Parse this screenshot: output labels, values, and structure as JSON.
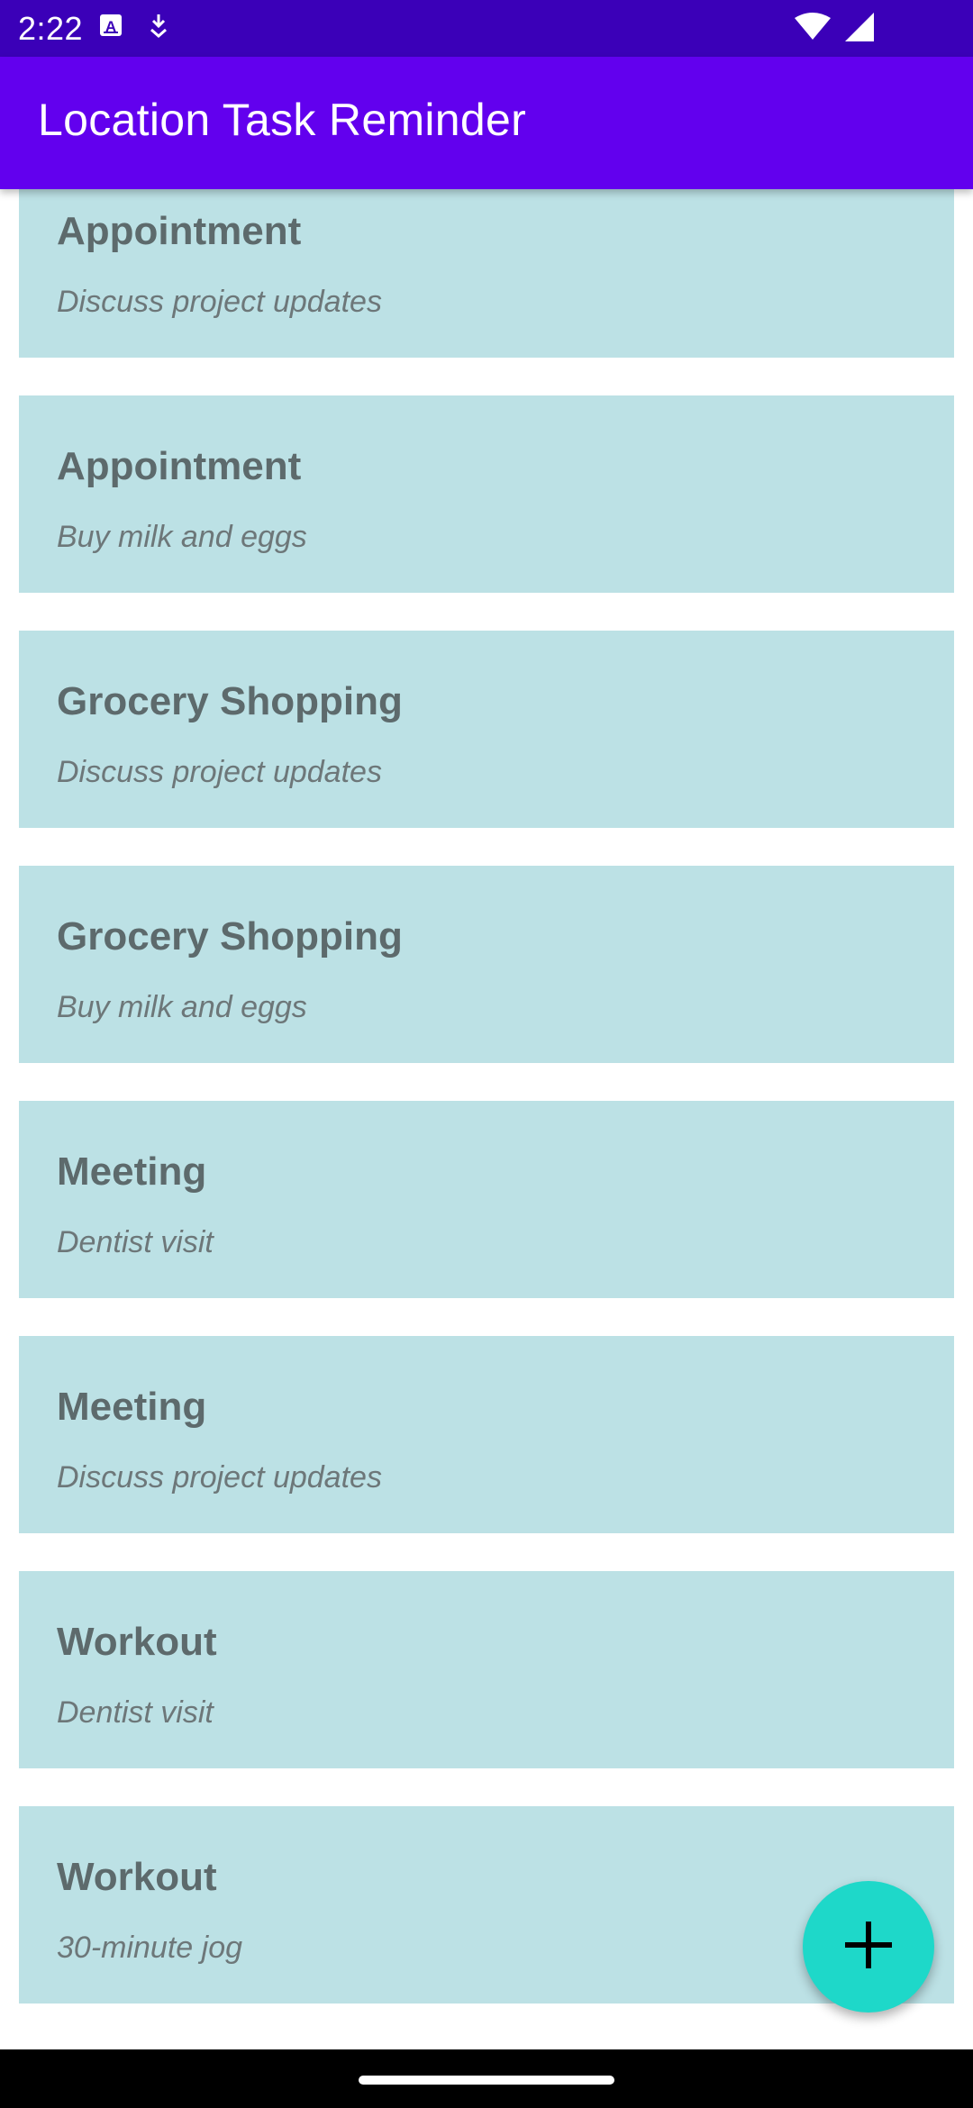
{
  "status_bar": {
    "time": "2:22",
    "icons": [
      "keyboard-a-icon",
      "download-icon",
      "wifi-icon",
      "signal-icon"
    ]
  },
  "app_bar": {
    "title": "Location Task Reminder"
  },
  "reminders": [
    {
      "title": "Appointment",
      "description": "Discuss project updates"
    },
    {
      "title": "Appointment",
      "description": "Buy milk and eggs"
    },
    {
      "title": "Grocery Shopping",
      "description": "Discuss project updates"
    },
    {
      "title": "Grocery Shopping",
      "description": "Buy milk and eggs"
    },
    {
      "title": "Meeting",
      "description": "Dentist visit"
    },
    {
      "title": "Meeting",
      "description": "Discuss project updates"
    },
    {
      "title": "Workout",
      "description": "Dentist visit"
    },
    {
      "title": "Workout",
      "description": "30-minute jog"
    }
  ],
  "fab": {
    "icon": "add-icon"
  },
  "colors": {
    "status_bar": "#3b00b8",
    "app_bar": "#6200ee",
    "card": "#bce1e5",
    "fab": "#1ed8c9"
  }
}
